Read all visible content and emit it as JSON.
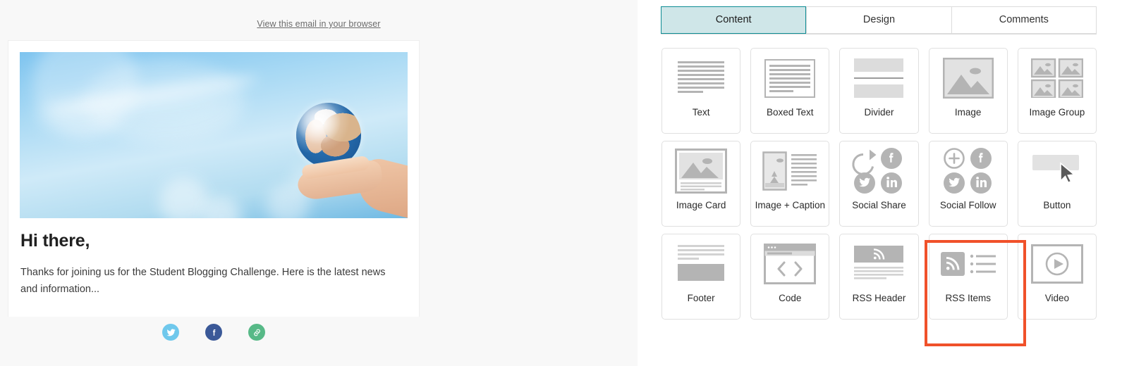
{
  "email_preview": {
    "browser_link": "View this email in your browser",
    "greeting": "Hi there,",
    "paragraph": "Thanks for joining us for the Student Blogging Challenge. Here is the latest news and information...",
    "hero_alt": "hand-holding-globe-sky-image",
    "social": [
      {
        "name": "twitter-icon",
        "glyph": "🐦",
        "color": "#6fc8ec"
      },
      {
        "name": "facebook-icon",
        "glyph": "f",
        "color": "#3b5998"
      },
      {
        "name": "link-icon",
        "glyph": "🔗",
        "color": "#57b987"
      }
    ]
  },
  "scrollbar": {
    "up_arrow": "▲"
  },
  "panel": {
    "tabs": [
      {
        "label": "Content",
        "active": true
      },
      {
        "label": "Design",
        "active": false
      },
      {
        "label": "Comments",
        "active": false
      }
    ],
    "blocks": [
      {
        "label": "Text",
        "icon": "text-lines-icon"
      },
      {
        "label": "Boxed Text",
        "icon": "boxed-text-icon"
      },
      {
        "label": "Divider",
        "icon": "divider-icon"
      },
      {
        "label": "Image",
        "icon": "image-icon"
      },
      {
        "label": "Image Group",
        "icon": "image-group-icon"
      },
      {
        "label": "Image Card",
        "icon": "image-card-icon"
      },
      {
        "label": "Image + Caption",
        "icon": "image-caption-icon"
      },
      {
        "label": "Social Share",
        "icon": "social-share-icon"
      },
      {
        "label": "Social Follow",
        "icon": "social-follow-icon"
      },
      {
        "label": "Button",
        "icon": "button-icon"
      },
      {
        "label": "Footer",
        "icon": "footer-icon"
      },
      {
        "label": "Code",
        "icon": "code-icon"
      },
      {
        "label": "RSS Header",
        "icon": "rss-header-icon"
      },
      {
        "label": "RSS Items",
        "icon": "rss-items-icon"
      },
      {
        "label": "Video",
        "icon": "video-icon"
      }
    ],
    "highlight": {
      "target_label": "RSS Items",
      "color": "#f0512a"
    },
    "colors": {
      "active_tab_bg": "#cfe6e8",
      "active_tab_border": "#0d8c94",
      "card_border": "#e0e0e0",
      "icon_gray": "#b4b4b4"
    }
  }
}
